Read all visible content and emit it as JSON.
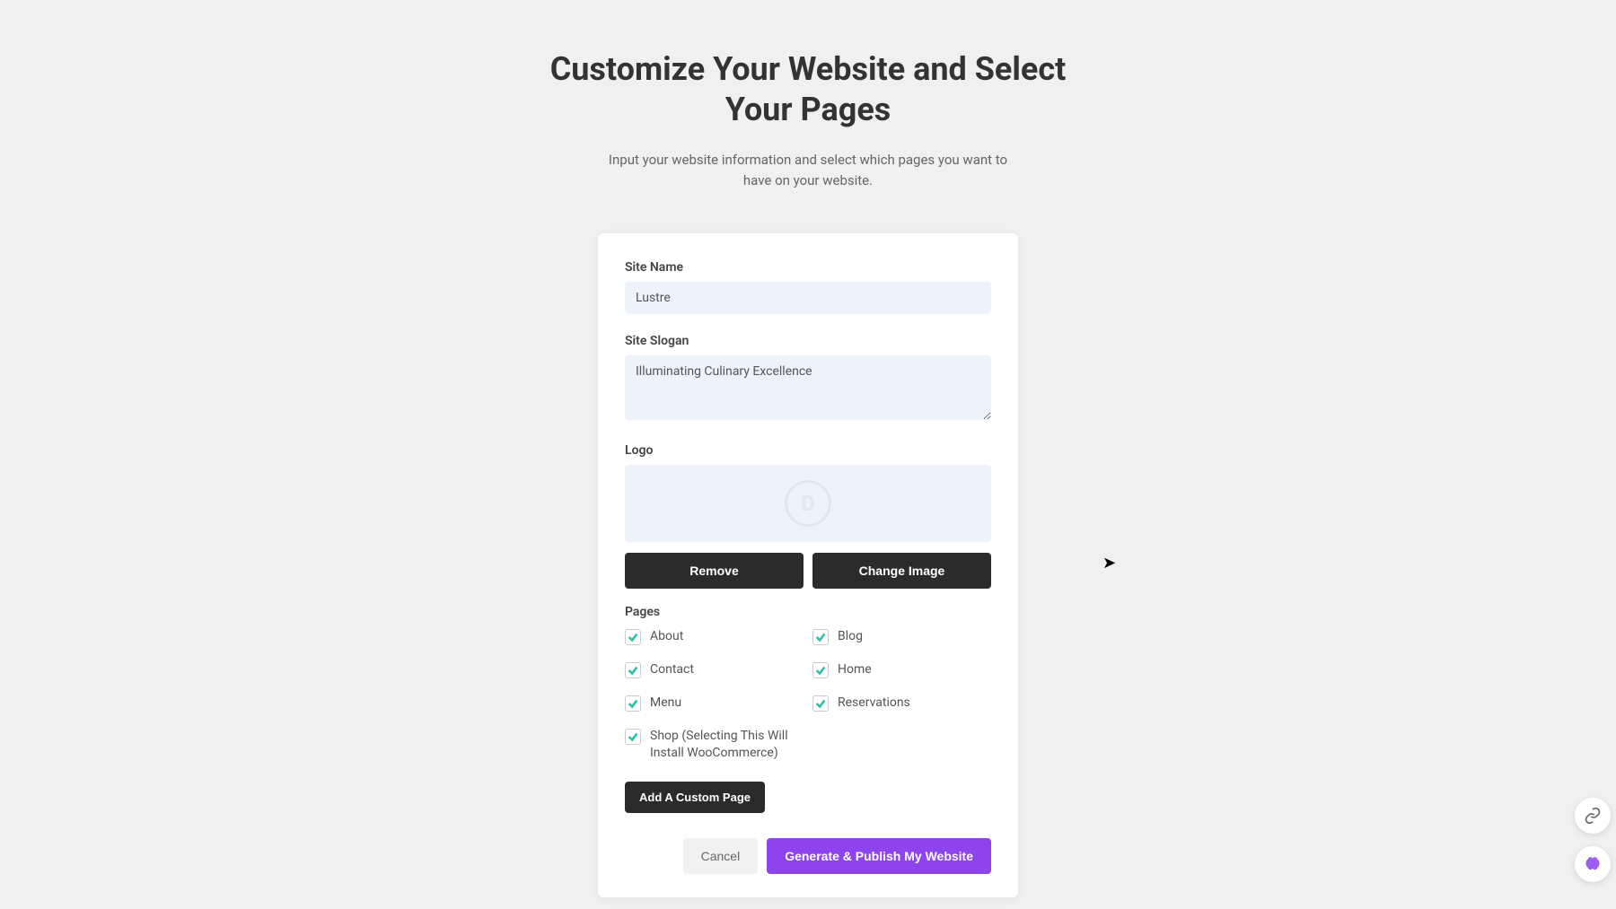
{
  "header": {
    "title": "Customize Your Website and Select Your Pages",
    "subtitle": "Input your website information and select which pages you want to have on your website."
  },
  "form": {
    "site_name_label": "Site Name",
    "site_name_value": "Lustre",
    "site_slogan_label": "Site Slogan",
    "site_slogan_value": "Illuminating Culinary Excellence",
    "logo_label": "Logo",
    "logo_placeholder_letter": "D",
    "remove_label": "Remove",
    "change_image_label": "Change Image",
    "pages_label": "Pages",
    "pages": [
      {
        "label": "About",
        "checked": true
      },
      {
        "label": "Blog",
        "checked": true
      },
      {
        "label": "Contact",
        "checked": true
      },
      {
        "label": "Home",
        "checked": true
      },
      {
        "label": "Menu",
        "checked": true
      },
      {
        "label": "Reservations",
        "checked": true
      },
      {
        "label": "Shop (Selecting This Will Install WooCommerce)",
        "checked": true
      }
    ],
    "add_custom_label": "Add A Custom Page"
  },
  "footer": {
    "cancel_label": "Cancel",
    "publish_label": "Generate & Publish My Website"
  },
  "colors": {
    "accent": "#8e44ec",
    "check": "#2fbfa7",
    "dark": "#2b2b2b"
  }
}
